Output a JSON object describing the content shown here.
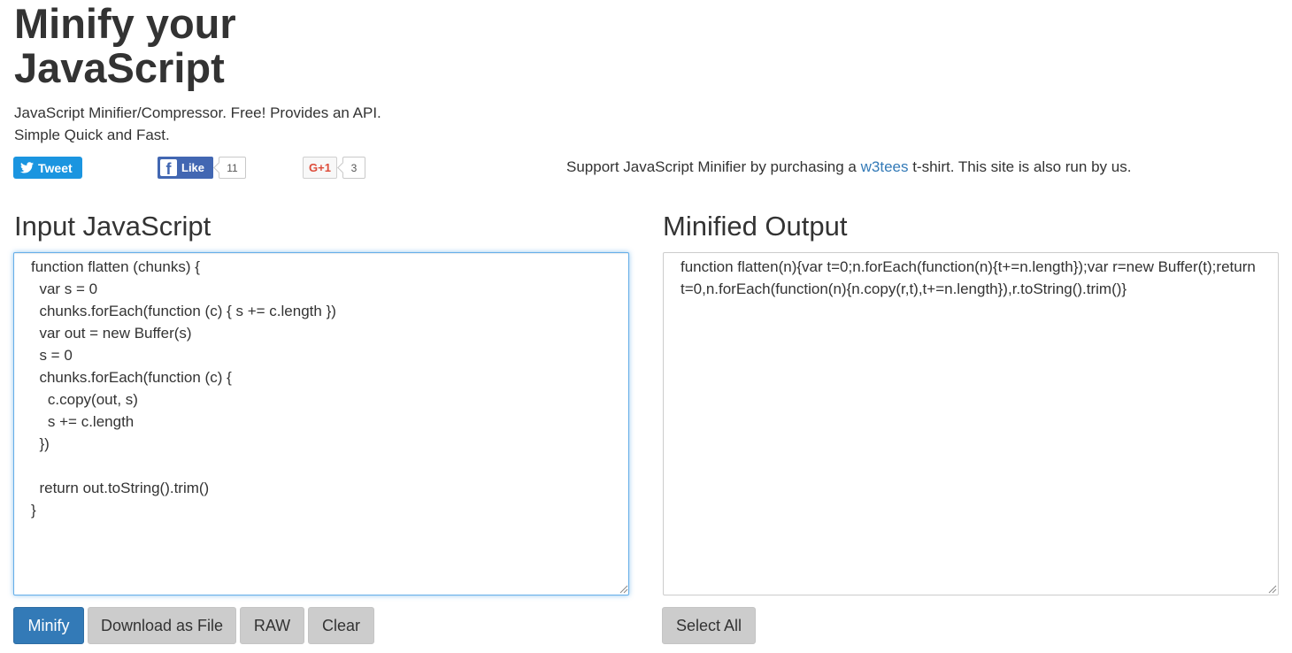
{
  "header": {
    "title": "Minify your JavaScript",
    "subtitle_line1": "JavaScript Minifier/Compressor. Free! Provides an API.",
    "subtitle_line2": "Simple Quick and Fast."
  },
  "social": {
    "tweet_label": "Tweet",
    "like_label": "Like",
    "like_count": "11",
    "gplus_label": "G+1",
    "gplus_count": "3"
  },
  "support": {
    "prefix": "Support JavaScript Minifier by purchasing a ",
    "link_text": "w3tees",
    "suffix": " t-shirt. This site is also run by us."
  },
  "input": {
    "title": "Input JavaScript",
    "code": "function flatten (chunks) {\n  var s = 0\n  chunks.forEach(function (c) { s += c.length })\n  var out = new Buffer(s)\n  s = 0\n  chunks.forEach(function (c) {\n    c.copy(out, s)\n    s += c.length\n  })\n\n  return out.toString().trim()\n}"
  },
  "output": {
    "title": "Minified Output",
    "code": "function flatten(n){var t=0;n.forEach(function(n){t+=n.length});var r=new Buffer(t);return t=0,n.forEach(function(n){n.copy(r,t),t+=n.length}),r.toString().trim()}"
  },
  "buttons": {
    "minify": "Minify",
    "download": "Download as File",
    "raw": "RAW",
    "clear": "Clear",
    "select_all": "Select All"
  },
  "colors": {
    "primary": "#337ab7",
    "button_gray": "#cccccc",
    "twitter": "#1b95e0",
    "facebook": "#4267b2",
    "gplus": "#dd4b39",
    "focus_border": "#66afe9"
  }
}
